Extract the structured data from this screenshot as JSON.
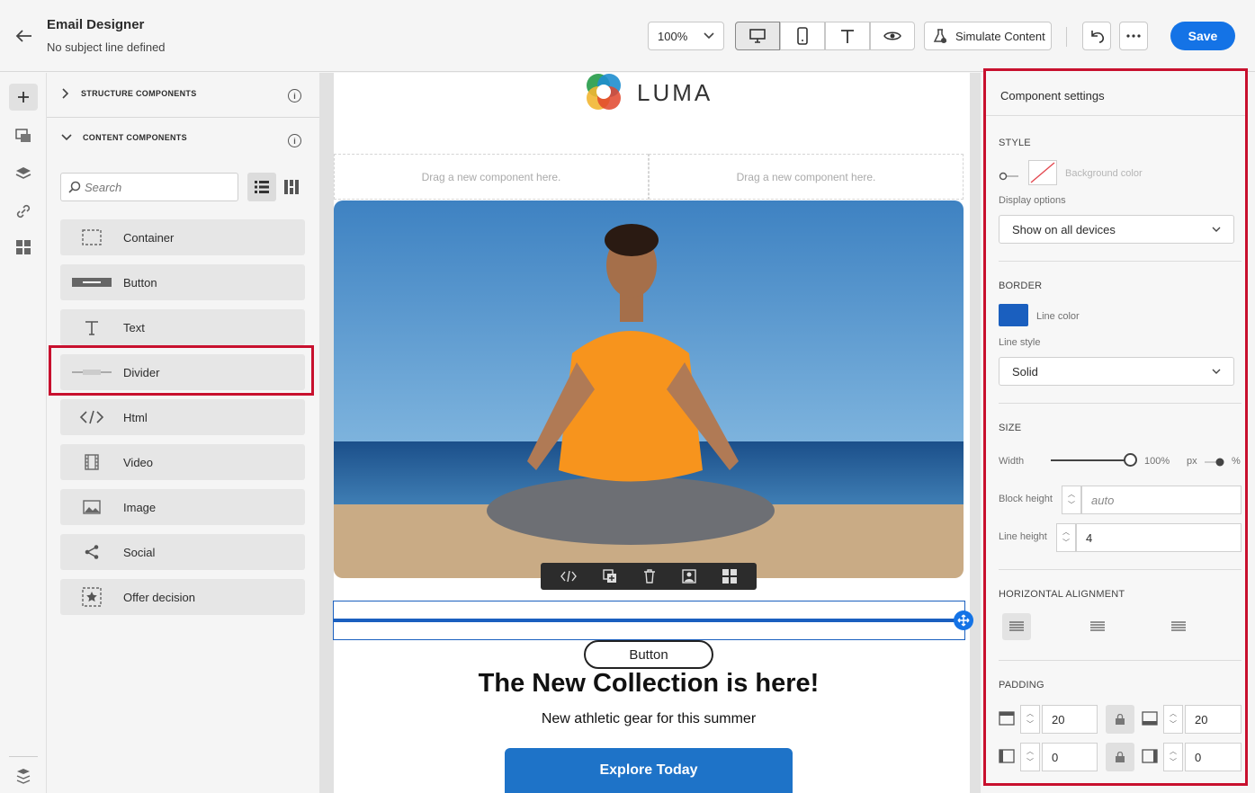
{
  "header": {
    "title": "Email Designer",
    "subtitle": "No subject line defined",
    "zoom": "100%",
    "simulate_label": "Simulate Content",
    "save_label": "Save"
  },
  "left_panel": {
    "structure_label": "STRUCTURE COMPONENTS",
    "content_label": "CONTENT COMPONENTS",
    "search_placeholder": "Search",
    "components": [
      {
        "label": "Container",
        "icon": "container-icon"
      },
      {
        "label": "Button",
        "icon": "button-icon"
      },
      {
        "label": "Text",
        "icon": "text-icon"
      },
      {
        "label": "Divider",
        "icon": "divider-icon"
      },
      {
        "label": "Html",
        "icon": "html-icon"
      },
      {
        "label": "Video",
        "icon": "video-icon"
      },
      {
        "label": "Image",
        "icon": "image-icon"
      },
      {
        "label": "Social",
        "icon": "social-icon"
      },
      {
        "label": "Offer decision",
        "icon": "offer-decision-icon"
      }
    ]
  },
  "canvas": {
    "logo_text": "LUMA",
    "drop_zone_1": "Drag a new component here.",
    "drop_zone_2": "Drag a new component here.",
    "small_button": "Button",
    "headline": "The New Collection is here!",
    "subline": "New athletic gear for this summer",
    "cta": "Explore Today"
  },
  "settings": {
    "title": "Component settings",
    "style_label": "STYLE",
    "bg_color_label": "Background color",
    "display_label": "Display options",
    "display_value": "Show on all devices",
    "border_label": "BORDER",
    "line_color_label": "Line color",
    "line_color": "#1a5fbf",
    "line_style_label": "Line style",
    "line_style_value": "Solid",
    "size_label": "SIZE",
    "width_label": "Width",
    "width_value": "100%",
    "px_label": "px",
    "pct_label": "%",
    "block_height_label": "Block height",
    "block_height_value": "auto",
    "line_height_label": "Line height",
    "line_height_value": "4",
    "halign_label": "HORIZONTAL ALIGNMENT",
    "padding_label": "PADDING",
    "pad_top": "20",
    "pad_bottom": "20",
    "pad_left": "0",
    "pad_right": "0"
  },
  "colors": {
    "accent": "#1473e6",
    "highlight": "#c8102e",
    "cta": "#1e73c8"
  }
}
